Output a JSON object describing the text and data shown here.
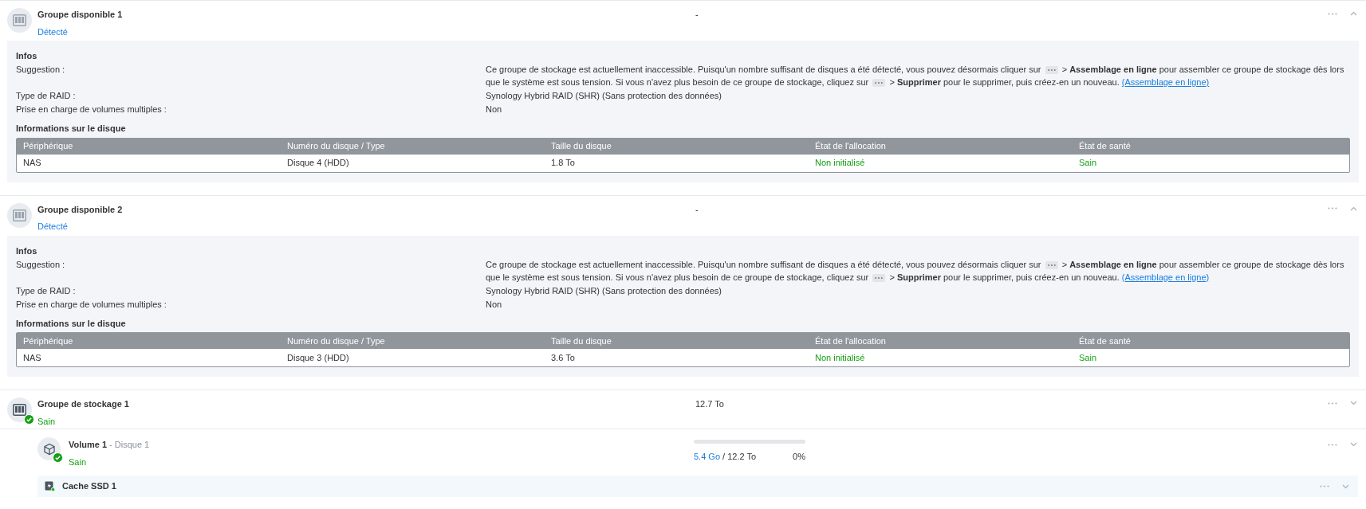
{
  "groups": [
    {
      "kind": "available",
      "title": "Groupe disponible 1",
      "status": "Détecté",
      "color": "#1a7fe0",
      "health_badge": false,
      "summary": "-",
      "expanded": true,
      "details": {
        "heading": "Infos",
        "rows": [
          {
            "kind": "rich",
            "label": "Suggestion :",
            "parts": [
              {
                "kind": "text",
                "text": "Ce groupe de stockage est actuellement inaccessible. Puisqu'un nombre suffisant de disques a été détecté, vous pouvez désormais cliquer sur"
              },
              {
                "kind": "chip"
              },
              {
                "kind": "text",
                "text": ">"
              },
              {
                "kind": "bold",
                "text": "Assemblage en ligne"
              },
              {
                "kind": "text",
                "text": "pour assembler ce groupe de stockage dès lors que le système est sous tension. Si vous n'avez plus besoin de ce groupe de stockage, cliquez sur"
              },
              {
                "kind": "chip"
              },
              {
                "kind": "text",
                "text": ">"
              },
              {
                "kind": "bold",
                "text": "Supprimer"
              },
              {
                "kind": "text",
                "text": "pour le supprimer, puis créez-en un nouveau."
              },
              {
                "kind": "link",
                "text": "(Assemblage en ligne)"
              }
            ]
          },
          {
            "kind": "text",
            "label": "Type de RAID :",
            "value": "Synology Hybrid RAID (SHR) (Sans protection des données)"
          },
          {
            "kind": "text",
            "label": "Prise en charge de volumes multiples :",
            "value": "Non"
          }
        ],
        "disk_heading": "Informations sur le disque",
        "disk_table": {
          "columns": [
            {
              "label": "Périphérique",
              "kind": "text"
            },
            {
              "label": "Numéro du disque / Type",
              "kind": "text"
            },
            {
              "label": "Taille du disque",
              "kind": "text"
            },
            {
              "label": "État de l'allocation",
              "kind": "status"
            },
            {
              "label": "État de santé",
              "kind": "status"
            }
          ],
          "rows": [
            [
              "NAS",
              "Disque 4 (HDD)",
              "1.8 To",
              "Non initialisé",
              "Sain"
            ]
          ]
        }
      }
    },
    {
      "kind": "available",
      "title": "Groupe disponible 2",
      "status": "Détecté",
      "color": "#1a7fe0",
      "health_badge": false,
      "summary": "-",
      "expanded": true,
      "details": {
        "heading": "Infos",
        "rows": [
          {
            "kind": "rich",
            "label": "Suggestion :",
            "parts": [
              {
                "kind": "text",
                "text": "Ce groupe de stockage est actuellement inaccessible. Puisqu'un nombre suffisant de disques a été détecté, vous pouvez désormais cliquer sur"
              },
              {
                "kind": "chip"
              },
              {
                "kind": "text",
                "text": ">"
              },
              {
                "kind": "bold",
                "text": "Assemblage en ligne"
              },
              {
                "kind": "text",
                "text": "pour assembler ce groupe de stockage dès lors que le système est sous tension. Si vous n'avez plus besoin de ce groupe de stockage, cliquez sur"
              },
              {
                "kind": "chip"
              },
              {
                "kind": "text",
                "text": ">"
              },
              {
                "kind": "bold",
                "text": "Supprimer"
              },
              {
                "kind": "text",
                "text": "pour le supprimer, puis créez-en un nouveau."
              },
              {
                "kind": "link",
                "text": "(Assemblage en ligne)"
              }
            ]
          },
          {
            "kind": "text",
            "label": "Type de RAID :",
            "value": "Synology Hybrid RAID (SHR) (Sans protection des données)"
          },
          {
            "kind": "text",
            "label": "Prise en charge de volumes multiples :",
            "value": "Non"
          }
        ],
        "disk_heading": "Informations sur le disque",
        "disk_table": {
          "columns": [
            {
              "label": "Périphérique",
              "kind": "text"
            },
            {
              "label": "Numéro du disque / Type",
              "kind": "text"
            },
            {
              "label": "Taille du disque",
              "kind": "text"
            },
            {
              "label": "État de l'allocation",
              "kind": "status"
            },
            {
              "label": "État de santé",
              "kind": "status"
            }
          ],
          "rows": [
            [
              "NAS",
              "Disque 3 (HDD)",
              "3.6 To",
              "Non initialisé",
              "Sain"
            ]
          ]
        }
      }
    },
    {
      "kind": "storage",
      "title": "Groupe de stockage 1",
      "status": "Sain",
      "color": "#14a014",
      "health_badge": true,
      "summary": "12.7 To",
      "expanded": false,
      "volumes": [
        {
          "title": "Volume 1",
          "subtitle": "- Disque 1",
          "status": "Sain",
          "color": "#14a014",
          "health_badge": true,
          "used": "5.4 Go",
          "total": "/ 12.2 To",
          "percent": "0%",
          "level": 0,
          "expanded": false
        }
      ],
      "caches": [
        {
          "title": "Cache SSD 1",
          "expanded": false
        }
      ]
    }
  ]
}
